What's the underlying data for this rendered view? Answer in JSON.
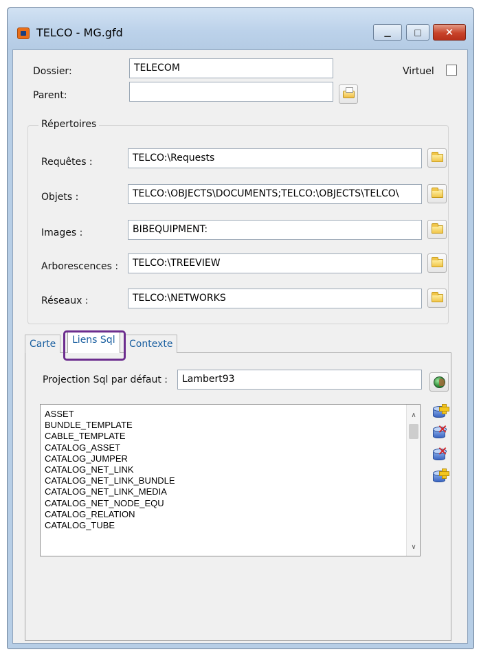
{
  "window": {
    "title": "TELCO - MG.gfd",
    "minimize_glyph": "▁",
    "maximize_glyph": "□",
    "close_glyph": "✕"
  },
  "form": {
    "dossier_label": "Dossier:",
    "dossier_value": "TELECOM",
    "parent_label": "Parent:",
    "parent_value": "",
    "virtuel_label": "Virtuel",
    "virtuel_checked": false
  },
  "repertoires": {
    "title": "Répertoires",
    "rows": [
      {
        "label": "Requêtes :",
        "value": "TELCO:\\Requests"
      },
      {
        "label": "Objets :",
        "value": "TELCO:\\OBJECTS\\DOCUMENTS;TELCO:\\OBJECTS\\TELCO\\"
      },
      {
        "label": "Images :",
        "value": "BIBEQUIPMENT:"
      },
      {
        "label": "Arborescences :",
        "value": "TELCO:\\TREEVIEW"
      },
      {
        "label": "Réseaux :",
        "value": "TELCO:\\NETWORKS"
      }
    ]
  },
  "tabs": [
    {
      "label": "Carte",
      "active": false
    },
    {
      "label": "Liens Sql",
      "active": true
    },
    {
      "label": "Contexte",
      "active": false
    }
  ],
  "liens_sql": {
    "projection_label": "Projection Sql par défaut :",
    "projection_value": "Lambert93",
    "list_items": [
      "ASSET",
      "BUNDLE_TEMPLATE",
      "CABLE_TEMPLATE",
      "CATALOG_ASSET",
      "CATALOG_JUMPER",
      "CATALOG_NET_LINK",
      "CATALOG_NET_LINK_BUNDLE",
      "CATALOG_NET_LINK_MEDIA",
      "CATALOG_NET_NODE_EQU",
      "CATALOG_RELATION",
      "CATALOG_TUBE"
    ],
    "scroll_up_glyph": "∧",
    "scroll_down_glyph": "∨"
  },
  "icons": {
    "app": "app-window-icon",
    "parent_browse": "printer-icon",
    "folder": "folder-icon",
    "globe": "globe-icon",
    "add_link": "add-database-link-icon",
    "delete_link": "delete-database-link-icon",
    "delete_all_links": "delete-all-links-icon",
    "add_all_links": "add-all-links-icon"
  },
  "colors": {
    "highlight_box": "#6c2d8e",
    "title_bar": "#bcd2ea",
    "close_button": "#c8432a"
  }
}
